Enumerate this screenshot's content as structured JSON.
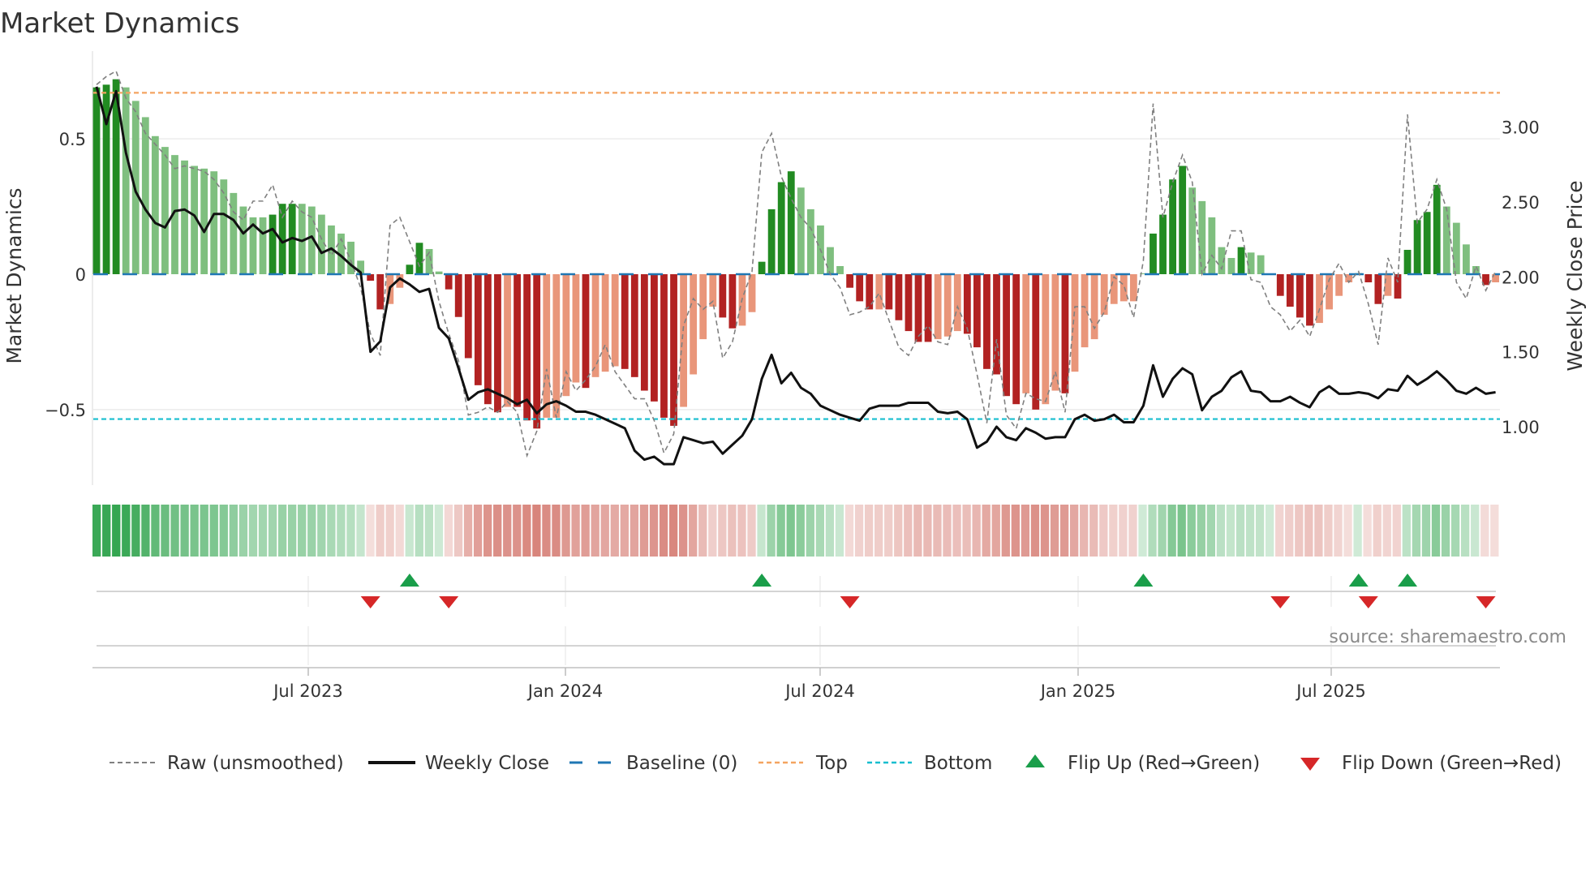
{
  "chart_data": {
    "type": "bar",
    "title": "Market Dynamics",
    "ylabel": "Market Dynamics",
    "ylabel_right": "Weekly Close Price",
    "xlabel": "",
    "x_unit": "weeks since first bar",
    "ylim": [
      -0.78,
      0.77
    ],
    "ylim_right": [
      0.61,
      3.41
    ],
    "yticks": [
      {
        "value": 0.5,
        "label": "0.5"
      },
      {
        "value": 0,
        "label": "0"
      },
      {
        "value": -0.5,
        "label": "−0.5"
      }
    ],
    "yticks_right": [
      {
        "value": 3.0,
        "label": "3.00"
      },
      {
        "value": 2.5,
        "label": "2.50"
      },
      {
        "value": 2.0,
        "label": "2.00"
      },
      {
        "value": 1.5,
        "label": "1.50"
      },
      {
        "value": 1.0,
        "label": "1.00"
      }
    ],
    "xticks": [
      {
        "week": 21.64,
        "label": "Jul 2023"
      },
      {
        "week": 47.93,
        "label": "Jan 2024"
      },
      {
        "week": 73.96,
        "label": "Jul 2024"
      },
      {
        "week": 100.33,
        "label": "Jan 2025"
      },
      {
        "week": 126.2,
        "label": "Jul 2025"
      }
    ],
    "top_level": 0.67,
    "bottom_level": -0.535,
    "baseline": 0,
    "values": [
      0.69,
      0.7,
      0.72,
      0.69,
      0.64,
      0.58,
      0.51,
      0.47,
      0.44,
      0.42,
      0.4,
      0.39,
      0.38,
      0.35,
      0.3,
      0.25,
      0.21,
      0.21,
      0.22,
      0.26,
      0.26,
      0.26,
      0.25,
      0.22,
      0.18,
      0.15,
      0.12,
      0.05,
      -0.024,
      -0.13,
      -0.11,
      -0.05,
      0.035,
      0.116,
      0.093,
      0.01,
      -0.056,
      -0.158,
      -0.31,
      -0.41,
      -0.48,
      -0.51,
      -0.49,
      -0.49,
      -0.54,
      -0.57,
      -0.53,
      -0.53,
      -0.45,
      -0.4,
      -0.42,
      -0.38,
      -0.36,
      -0.34,
      -0.35,
      -0.38,
      -0.43,
      -0.47,
      -0.53,
      -0.56,
      -0.49,
      -0.37,
      -0.24,
      -0.12,
      -0.16,
      -0.2,
      -0.19,
      -0.14,
      0.046,
      0.24,
      0.34,
      0.38,
      0.32,
      0.24,
      0.18,
      0.1,
      0.03,
      -0.05,
      -0.1,
      -0.13,
      -0.13,
      -0.13,
      -0.17,
      -0.21,
      -0.25,
      -0.25,
      -0.24,
      -0.23,
      -0.21,
      -0.22,
      -0.27,
      -0.35,
      -0.37,
      -0.45,
      -0.48,
      -0.44,
      -0.5,
      -0.48,
      -0.43,
      -0.44,
      -0.36,
      -0.27,
      -0.24,
      -0.15,
      -0.11,
      -0.1,
      -0.1,
      0.003,
      0.15,
      0.22,
      0.35,
      0.4,
      0.32,
      0.27,
      0.21,
      0.1,
      0.06,
      0.1,
      0.08,
      0.07,
      0.003,
      -0.08,
      -0.12,
      -0.16,
      -0.19,
      -0.18,
      -0.13,
      -0.08,
      -0.03,
      0.004,
      -0.03,
      -0.11,
      -0.08,
      -0.09,
      0.09,
      0.2,
      0.23,
      0.33,
      0.25,
      0.19,
      0.11,
      0.03,
      -0.04,
      -0.03
    ],
    "strong": [
      1,
      1,
      1,
      0,
      0,
      0,
      0,
      0,
      0,
      0,
      0,
      0,
      0,
      0,
      0,
      0,
      0,
      0,
      1,
      1,
      1,
      0,
      0,
      0,
      0,
      0,
      0,
      0,
      1,
      1,
      0,
      0,
      1,
      1,
      0,
      0,
      1,
      1,
      1,
      1,
      1,
      1,
      0,
      1,
      1,
      1,
      0,
      0,
      0,
      0,
      1,
      0,
      0,
      0,
      1,
      1,
      1,
      1,
      1,
      1,
      0,
      0,
      0,
      0,
      1,
      1,
      0,
      0,
      1,
      1,
      1,
      1,
      0,
      0,
      0,
      0,
      0,
      1,
      1,
      1,
      0,
      1,
      1,
      1,
      1,
      1,
      0,
      0,
      0,
      1,
      1,
      1,
      1,
      1,
      1,
      0,
      1,
      0,
      0,
      1,
      0,
      0,
      0,
      0,
      0,
      0,
      0,
      0,
      1,
      1,
      1,
      1,
      0,
      0,
      0,
      0,
      0,
      1,
      0,
      0,
      0,
      1,
      1,
      1,
      1,
      0,
      0,
      0,
      0,
      0,
      1,
      1,
      0,
      1,
      1,
      1,
      1,
      1,
      0,
      0,
      0,
      0,
      1,
      0
    ],
    "raw": [
      0.7,
      0.73,
      0.75,
      0.65,
      0.6,
      0.52,
      0.48,
      0.44,
      0.39,
      0.4,
      0.39,
      0.38,
      0.35,
      0.3,
      0.23,
      0.2,
      0.27,
      0.27,
      0.33,
      0.21,
      0.27,
      0.23,
      0.21,
      0.13,
      0.07,
      0.13,
      0.05,
      -0.05,
      -0.22,
      -0.3,
      0.18,
      0.21,
      0.12,
      0.03,
      0.08,
      -0.1,
      -0.22,
      -0.32,
      -0.52,
      -0.51,
      -0.49,
      -0.51,
      -0.47,
      -0.51,
      -0.67,
      -0.58,
      -0.35,
      -0.53,
      -0.36,
      -0.43,
      -0.39,
      -0.34,
      -0.26,
      -0.36,
      -0.41,
      -0.46,
      -0.46,
      -0.54,
      -0.66,
      -0.59,
      -0.19,
      -0.09,
      -0.13,
      -0.1,
      -0.31,
      -0.25,
      -0.09,
      0.01,
      0.45,
      0.52,
      0.36,
      0.28,
      0.21,
      0.17,
      0.09,
      0.0,
      -0.05,
      -0.15,
      -0.14,
      -0.12,
      -0.07,
      -0.17,
      -0.27,
      -0.3,
      -0.23,
      -0.19,
      -0.25,
      -0.26,
      -0.12,
      -0.2,
      -0.37,
      -0.55,
      -0.24,
      -0.52,
      -0.57,
      -0.44,
      -0.46,
      -0.47,
      -0.36,
      -0.51,
      -0.12,
      -0.12,
      -0.2,
      -0.14,
      -0.01,
      -0.04,
      -0.16,
      0.05,
      0.63,
      0.21,
      0.34,
      0.44,
      0.34,
      0.0,
      0.07,
      0.02,
      0.16,
      0.16,
      -0.02,
      -0.03,
      -0.12,
      -0.15,
      -0.21,
      -0.17,
      -0.23,
      -0.13,
      -0.02,
      0.04,
      -0.03,
      0.01,
      -0.11,
      -0.26,
      0.06,
      -0.03,
      0.59,
      0.19,
      0.24,
      0.35,
      0.24,
      -0.03,
      -0.09,
      0.03,
      -0.06,
      0.01
    ],
    "close": [
      3.27,
      3.02,
      3.24,
      2.83,
      2.57,
      2.45,
      2.36,
      2.33,
      2.44,
      2.45,
      2.41,
      2.3,
      2.42,
      2.42,
      2.38,
      2.29,
      2.35,
      2.29,
      2.32,
      2.23,
      2.26,
      2.24,
      2.27,
      2.16,
      2.19,
      2.14,
      2.08,
      2.03,
      1.5,
      1.57,
      1.93,
      1.99,
      1.95,
      1.9,
      1.92,
      1.66,
      1.59,
      1.39,
      1.18,
      1.23,
      1.25,
      1.22,
      1.19,
      1.15,
      1.18,
      1.09,
      1.15,
      1.17,
      1.14,
      1.1,
      1.1,
      1.08,
      1.05,
      1.02,
      0.99,
      0.84,
      0.78,
      0.8,
      0.75,
      0.75,
      0.93,
      0.91,
      0.89,
      0.9,
      0.82,
      0.88,
      0.94,
      1.05,
      1.32,
      1.48,
      1.29,
      1.36,
      1.26,
      1.22,
      1.14,
      1.11,
      1.08,
      1.06,
      1.04,
      1.12,
      1.14,
      1.14,
      1.14,
      1.16,
      1.16,
      1.16,
      1.1,
      1.09,
      1.1,
      1.05,
      0.86,
      0.9,
      1.0,
      0.93,
      0.91,
      0.99,
      0.96,
      0.92,
      0.93,
      0.93,
      1.05,
      1.08,
      1.04,
      1.05,
      1.08,
      1.03,
      1.03,
      1.14,
      1.41,
      1.2,
      1.32,
      1.39,
      1.35,
      1.11,
      1.2,
      1.24,
      1.33,
      1.37,
      1.24,
      1.23,
      1.17,
      1.17,
      1.2,
      1.16,
      1.13,
      1.23,
      1.27,
      1.22,
      1.22,
      1.23,
      1.22,
      1.19,
      1.25,
      1.24,
      1.34,
      1.28,
      1.32,
      1.37,
      1.31,
      1.24,
      1.22,
      1.26,
      1.22,
      1.23
    ],
    "flip_up_weeks": [
      32,
      68,
      107,
      129,
      134
    ],
    "flip_down_weeks": [
      28,
      36,
      77,
      121,
      130,
      142
    ],
    "legend_position": "bottom",
    "legend": {
      "raw": "Raw (unsmoothed)",
      "close": "Weekly Close",
      "baseline": "Baseline (0)",
      "top": "Top",
      "bottom": "Bottom",
      "flip_up": "Flip Up (Red→Green)",
      "flip_down": "Flip Down (Green→Red)"
    },
    "colors": {
      "green_strong": "#228b22",
      "green_weak": "#7fbf7f",
      "red_strong": "#b22222",
      "red_weak": "#e9967a",
      "baseline": "#1f77b4",
      "top": "#f4a460",
      "bottom": "#17becf",
      "raw": "#808080",
      "close": "#111111",
      "flip_up": "#1a9e4a",
      "flip_down": "#d62728"
    }
  },
  "source": "source: sharemaestro.com"
}
